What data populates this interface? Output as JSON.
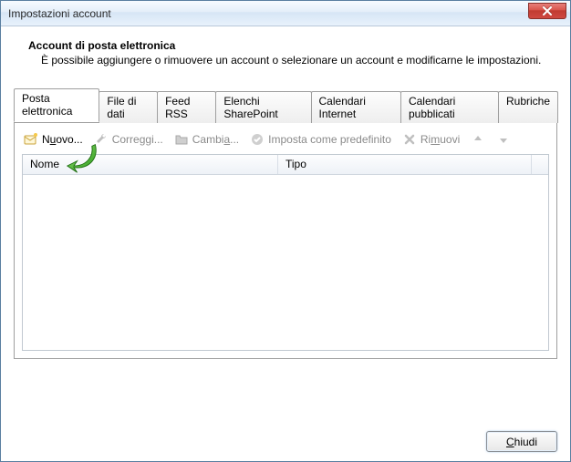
{
  "window": {
    "title": "Impostazioni account"
  },
  "heading": {
    "title": "Account di posta elettronica",
    "description": "È possibile aggiungere o rimuovere un account o selezionare un account e modificarne le impostazioni."
  },
  "tabs": [
    {
      "label": "Posta elettronica",
      "active": true
    },
    {
      "label": "File di dati",
      "active": false
    },
    {
      "label": "Feed RSS",
      "active": false
    },
    {
      "label": "Elenchi SharePoint",
      "active": false
    },
    {
      "label": "Calendari Internet",
      "active": false
    },
    {
      "label": "Calendari pubblicati",
      "active": false
    },
    {
      "label": "Rubriche",
      "active": false
    }
  ],
  "toolbar": {
    "new_pre": "N",
    "new_u": "u",
    "new_post": "ovo...",
    "fix_label": "Correggi...",
    "change_pre": "Cambi",
    "change_u": "a",
    "change_post": "...",
    "default_label": "Imposta come predefinito",
    "remove_pre": "Ri",
    "remove_u": "m",
    "remove_post": "uovi"
  },
  "columns": {
    "name": "Nome",
    "type": "Tipo"
  },
  "footer": {
    "close_pre": "",
    "close_u": "C",
    "close_post": "hiudi"
  }
}
